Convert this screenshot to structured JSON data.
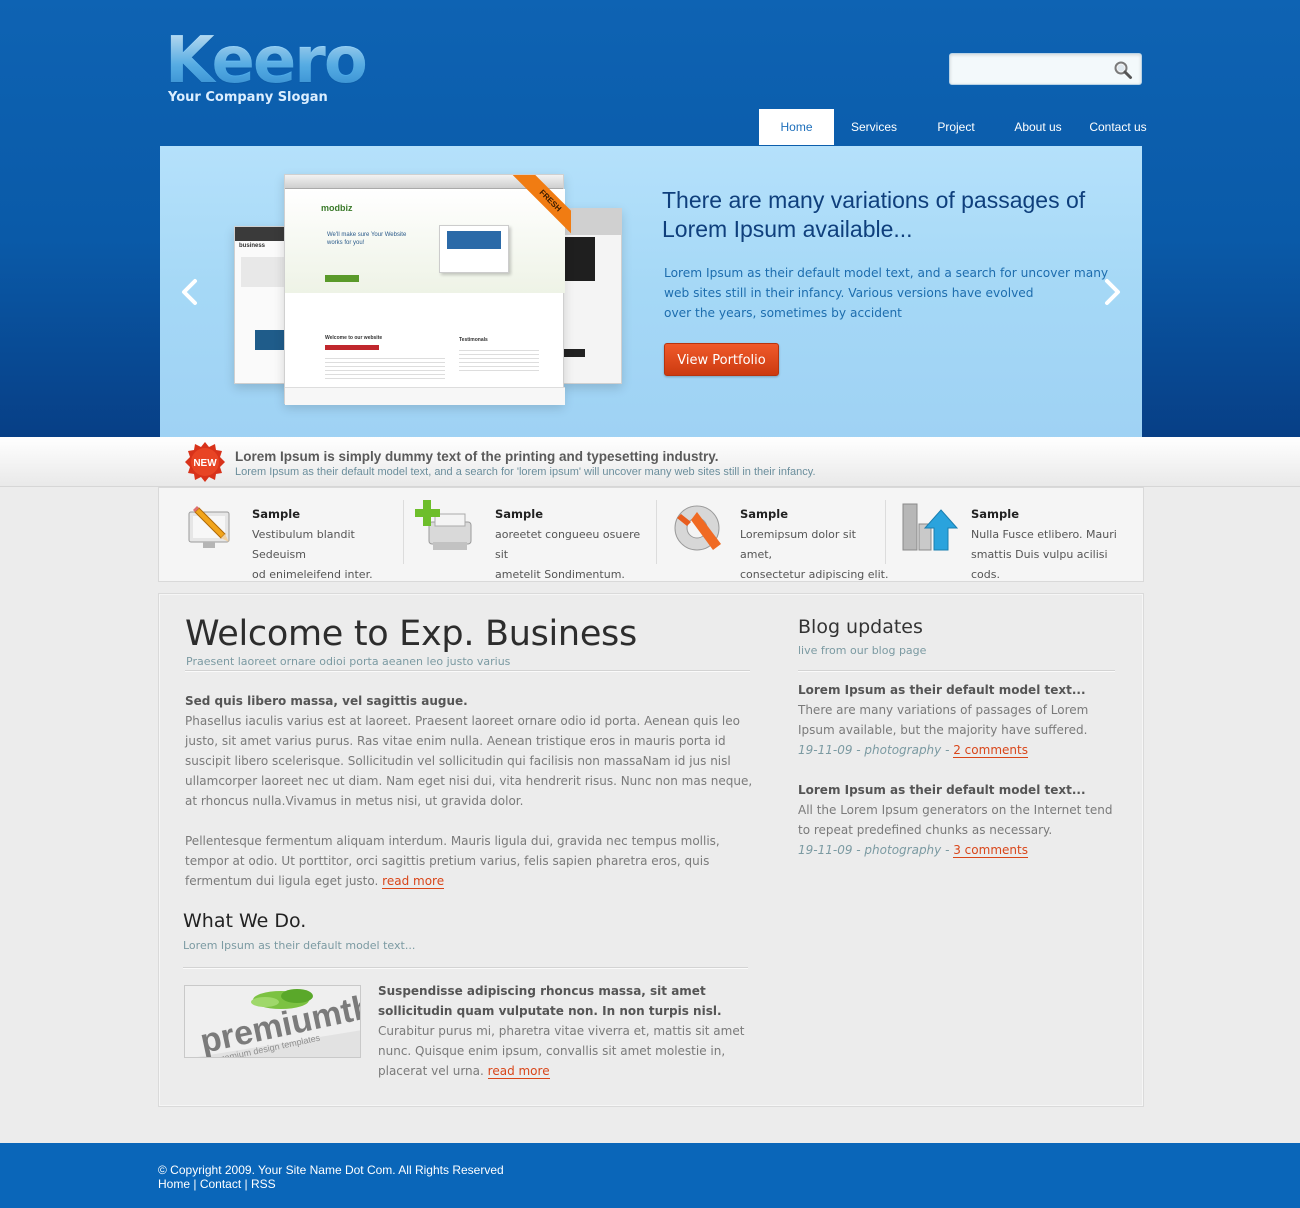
{
  "header": {
    "logo": "Keero",
    "slogan": "Your Company Slogan",
    "search_placeholder": ""
  },
  "nav": {
    "items": [
      {
        "label": "Home",
        "active": true
      },
      {
        "label": "Services"
      },
      {
        "label": "Project"
      },
      {
        "label": "About us"
      },
      {
        "label": "Contact us"
      }
    ]
  },
  "slider": {
    "title": "There are many variations of passages of Lorem Ipsum available...",
    "body": [
      "Lorem Ipsum as their default model text, and a search for uncover many",
      "web sites still in their infancy. Various versions have evolved",
      "over the years, sometimes by accident"
    ],
    "button": "View Portfolio",
    "badge": "FRESH",
    "mock_brand": "modbiz",
    "mock_brand_left": "business",
    "mock_headline": "We'll make sure Your Website works for you!",
    "mock_welcome": "Welcome to our website",
    "mock_testimonials": "Testimonals"
  },
  "news": {
    "badge": "NEW",
    "title": "Lorem Ipsum is simply dummy text of the printing and typesetting industry.",
    "subtitle": "Lorem Ipsum as their default model text, and a search for 'lorem ipsum' will uncover many web sites still in their infancy."
  },
  "features": [
    {
      "icon": "pencil-monitor-icon",
      "title": "Sample",
      "lines": [
        "Vestibulum blandit Sedeuism",
        "od enimeleifend inter."
      ]
    },
    {
      "icon": "printer-plus-icon",
      "title": "Sample",
      "lines": [
        "aoreetet congueeu osuere sit",
        "ametelit Sondimentum."
      ]
    },
    {
      "icon": "lifebuoy-icon",
      "title": "Sample",
      "lines": [
        "Loremipsum dolor sit amet,",
        "consectetur adipiscing elit."
      ]
    },
    {
      "icon": "bar-chart-arrow-icon",
      "title": "Sample",
      "lines": [
        "Nulla Fusce etlibero. Mauri",
        "smattis Duis vulpu acilisi cods."
      ]
    }
  ],
  "main": {
    "title": "Welcome to Exp. Business",
    "subtitle": "Praesent laoreet ornare odioi porta aeanen leo justo varius",
    "intro_bold": "Sed quis libero massa, vel sagittis augue.",
    "para1": "Phasellus iaculis varius est at laoreet. Praesent laoreet ornare odio id porta. Aenean quis leo justo, sit amet varius purus. Ras vitae enim nulla. Aenean tristique eros in mauris porta id suscipit libero scelerisque. Sollicitudin vel sollicitudin qui facilisis non massaNam id jus nisl ullamcorper laoreet nec ut diam. Nam eget nisi dui, vita hendrerit risus. Nunc non mas neque, at rhoncus nulla.Vivamus in metus nisi, ut gravida dolor.",
    "para2": "Pellentesque fermentum aliquam interdum. Mauris ligula dui, gravida nec tempus mollis, tempor at odio. Ut porttitor, orci sagittis pretium varius, felis sapien pharetra eros, quis fermentum dui ligula eget justo.",
    "read_more": "read more",
    "what_title": "What We Do.",
    "what_subtitle": "Lorem Ipsum as their default model text...",
    "what_bold": "Suspendisse adipiscing rhoncus massa, sit amet sollicitudin quam vulputate non. In non turpis nisl.",
    "what_body": "Curabitur purus mi, pharetra vitae viverra et, mattis sit amet nunc. Quisque enim ipsum, convallis sit amet molestie in, placerat vel urna.",
    "what_read_more": "read more",
    "thumb_brand": "premiumth",
    "thumb_tagline": "premium design templates"
  },
  "blog": {
    "title": "Blog updates",
    "subtitle": "live from our blog page",
    "posts": [
      {
        "title": "Lorem Ipsum as their default model text...",
        "body": "There are many variations of passages of Lorem Ipsum available, but the majority have suffered.",
        "meta": "19-11-09 - photography - ",
        "comments": "2 comments"
      },
      {
        "title": "Lorem Ipsum as their default model text...",
        "body": "All the Lorem Ipsum generators on the Internet tend to repeat predefined chunks as necessary.",
        "meta": "19-11-09 - photography - ",
        "comments": "3 comments"
      }
    ]
  },
  "footer": {
    "copyright": "© Copyright 2009. Your Site Name Dot Com. All Rights Reserved",
    "links": [
      "Home",
      "Contact",
      "RSS"
    ],
    "sep": "|"
  }
}
